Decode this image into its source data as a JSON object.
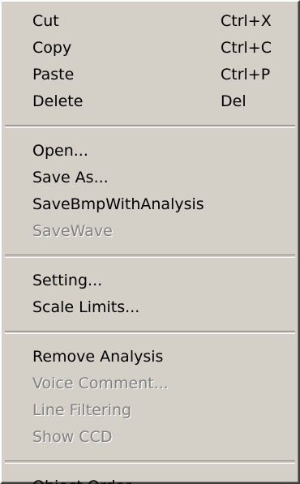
{
  "menu": {
    "cut": {
      "label": "Cut",
      "shortcut": "Ctrl+X"
    },
    "copy": {
      "label": "Copy",
      "shortcut": "Ctrl+C"
    },
    "paste": {
      "label": "Paste",
      "shortcut": "Ctrl+P"
    },
    "delete": {
      "label": "Delete",
      "shortcut": "Del"
    },
    "open": {
      "label": "Open..."
    },
    "save_as": {
      "label": "Save As..."
    },
    "save_bmp": {
      "label": "SaveBmpWithAnalysis"
    },
    "save_wave": {
      "label": "SaveWave"
    },
    "setting": {
      "label": "Setting..."
    },
    "scale_limits": {
      "label": "Scale Limits..."
    },
    "remove_analysis": {
      "label": "Remove Analysis"
    },
    "voice_comment": {
      "label": "Voice Comment..."
    },
    "line_filtering": {
      "label": "Line Filtering"
    },
    "show_ccd": {
      "label": "Show CCD"
    },
    "object_order": {
      "label": "Object Order",
      "submenu_icon": "triangle-right-icon"
    }
  },
  "colors": {
    "background": "#d4d0c8",
    "disabled_text": "#808080",
    "text": "#000000"
  }
}
